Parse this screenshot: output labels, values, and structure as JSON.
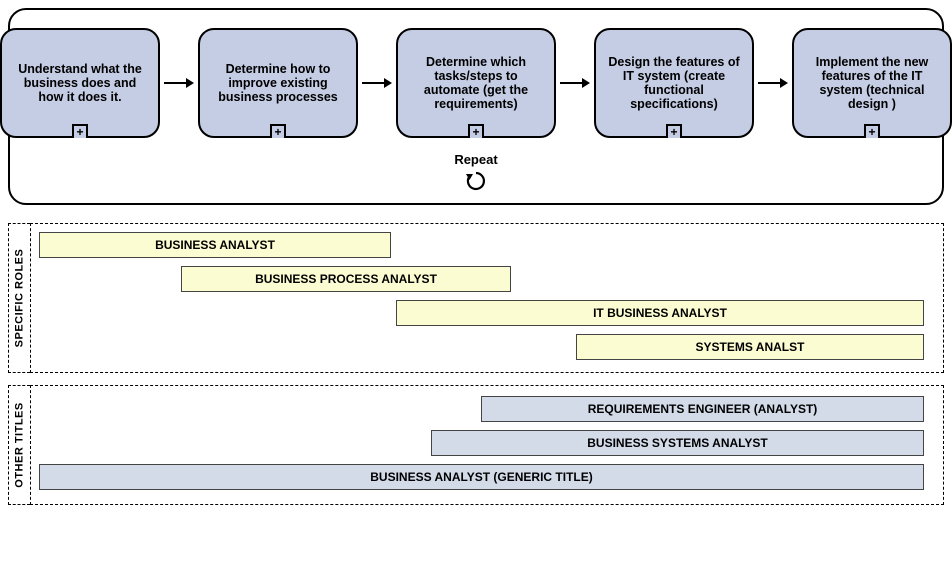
{
  "process": {
    "steps": [
      {
        "label": "Understand what the business does and how it does it."
      },
      {
        "label": "Determine how to improve existing business processes"
      },
      {
        "label": "Determine which tasks/steps to automate (get the requirements)"
      },
      {
        "label": "Design the features of IT system (create functional specifications)"
      },
      {
        "label": "Implement the new features of the IT system (technical design )"
      }
    ],
    "expand_marker": "+",
    "repeat_label": "Repeat"
  },
  "lanes": {
    "specific": {
      "title": "SPECIFIC ROLES",
      "bars": [
        {
          "label": "BUSINESS ANALYST"
        },
        {
          "label": "BUSINESS PROCESS ANALYST"
        },
        {
          "label": "IT BUSINESS ANALYST"
        },
        {
          "label": "SYSTEMS ANALST"
        }
      ]
    },
    "other": {
      "title": "OTHER TITLES",
      "bars": [
        {
          "label": "REQUIREMENTS ENGINEER (ANALYST)"
        },
        {
          "label": "BUSINESS SYSTEMS ANALYST"
        },
        {
          "label": "BUSINESS ANALYST (GENERIC TITLE)"
        }
      ]
    }
  }
}
